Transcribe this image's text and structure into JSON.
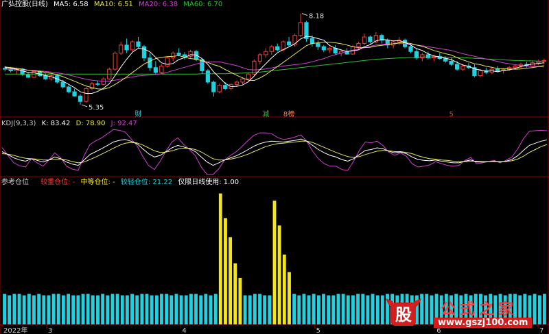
{
  "header1": {
    "title": "广弘控股(日线)",
    "ma5": "MA5: 6.58",
    "ma10": "MA10: 6.51",
    "ma20": "MA20: 6.38",
    "ma60": "MA60: 6.70"
  },
  "header2": {
    "title": "KDJ(9,3,3)",
    "k": "K: 83.42",
    "d": "D: 78.90",
    "j": "J: 92.47"
  },
  "header3": {
    "title": "参考仓位",
    "heavy": "较重仓位: -",
    "medium": "中等仓位: -",
    "light": "较轻仓位: 21.22",
    "note": "仅限日线使用: 1.00"
  },
  "markers": [
    "财",
    "减",
    "8榜",
    "5"
  ],
  "watermark": {
    "logo_char": "股",
    "title": "公式之家",
    "url": "www.gszj100.com"
  },
  "colors": {
    "up": "#ff3b3b",
    "down": "#22d0e0",
    "ma5": "#ffffff",
    "ma10": "#e8e85a",
    "ma20": "#d040d0",
    "ma60": "#30c030",
    "k": "#ffffff",
    "d": "#e8e85a",
    "j": "#d040d0",
    "bar_light": "#22d0e0",
    "bar_medium": "#f4e41a",
    "grid": "#8b0000"
  },
  "chart_data": [
    {
      "type": "candlestick",
      "title": "广弘控股(日线)",
      "x_ticks": [
        "2022年",
        "3",
        "4",
        "5",
        "6",
        "7"
      ],
      "annotations": [
        {
          "text": "8.18",
          "kind": "high"
        },
        {
          "text": "5.35",
          "kind": "low"
        }
      ],
      "ylim": [
        5.2,
        8.3
      ],
      "ohlc": [
        [
          6.48,
          6.55,
          6.38,
          6.45
        ],
        [
          6.45,
          6.52,
          6.35,
          6.4
        ],
        [
          6.4,
          6.5,
          6.3,
          6.46
        ],
        [
          6.46,
          6.48,
          6.25,
          6.28
        ],
        [
          6.28,
          6.34,
          6.18,
          6.2
        ],
        [
          6.2,
          6.4,
          6.18,
          6.38
        ],
        [
          6.38,
          6.42,
          6.22,
          6.25
        ],
        [
          6.25,
          6.32,
          6.12,
          6.15
        ],
        [
          6.15,
          6.28,
          6.1,
          6.25
        ],
        [
          6.25,
          6.3,
          6.0,
          6.05
        ],
        [
          6.05,
          6.12,
          5.85,
          5.9
        ],
        [
          5.9,
          5.95,
          5.7,
          5.75
        ],
        [
          5.75,
          5.85,
          5.6,
          5.62
        ],
        [
          5.62,
          5.68,
          5.35,
          5.45
        ],
        [
          5.45,
          5.9,
          5.42,
          5.85
        ],
        [
          5.85,
          6.05,
          5.8,
          6.0
        ],
        [
          6.0,
          6.1,
          5.92,
          5.98
        ],
        [
          5.98,
          6.2,
          5.95,
          6.15
        ],
        [
          6.15,
          6.5,
          6.12,
          6.45
        ],
        [
          6.45,
          7.0,
          6.4,
          6.95
        ],
        [
          6.95,
          7.3,
          6.9,
          7.2
        ],
        [
          7.2,
          7.4,
          6.95,
          7.05
        ],
        [
          7.05,
          7.35,
          7.0,
          7.3
        ],
        [
          7.3,
          7.45,
          7.1,
          7.15
        ],
        [
          7.15,
          7.2,
          6.7,
          6.8
        ],
        [
          6.8,
          6.95,
          6.4,
          6.5
        ],
        [
          6.5,
          6.7,
          6.3,
          6.35
        ],
        [
          6.35,
          6.6,
          6.3,
          6.55
        ],
        [
          6.55,
          6.85,
          6.5,
          6.8
        ],
        [
          6.8,
          7.0,
          6.7,
          6.95
        ],
        [
          6.95,
          7.1,
          6.85,
          6.9
        ],
        [
          6.9,
          6.98,
          6.75,
          6.85
        ],
        [
          6.85,
          7.05,
          6.8,
          7.0
        ],
        [
          7.0,
          7.05,
          6.7,
          6.75
        ],
        [
          6.75,
          6.8,
          6.3,
          6.4
        ],
        [
          6.4,
          6.45,
          6.0,
          6.05
        ],
        [
          6.05,
          6.1,
          5.6,
          5.75
        ],
        [
          5.75,
          6.0,
          5.7,
          5.95
        ],
        [
          5.95,
          6.05,
          5.8,
          5.85
        ],
        [
          5.85,
          6.0,
          5.8,
          5.98
        ],
        [
          5.98,
          6.1,
          5.9,
          6.05
        ],
        [
          6.05,
          6.2,
          5.98,
          6.15
        ],
        [
          6.15,
          6.35,
          6.1,
          6.3
        ],
        [
          6.3,
          6.75,
          6.25,
          6.7
        ],
        [
          6.7,
          6.95,
          6.6,
          6.9
        ],
        [
          6.9,
          7.1,
          6.8,
          7.0
        ],
        [
          7.0,
          7.2,
          6.9,
          7.15
        ],
        [
          7.15,
          7.25,
          7.0,
          7.05
        ],
        [
          7.05,
          7.35,
          7.0,
          7.3
        ],
        [
          7.3,
          7.45,
          7.15,
          7.2
        ],
        [
          7.2,
          7.55,
          7.15,
          7.5
        ],
        [
          7.5,
          8.18,
          7.45,
          7.9
        ],
        [
          7.9,
          7.95,
          7.3,
          7.4
        ],
        [
          7.4,
          7.5,
          7.15,
          7.25
        ],
        [
          7.25,
          7.35,
          7.05,
          7.15
        ],
        [
          7.15,
          7.2,
          6.98,
          7.05
        ],
        [
          7.05,
          7.15,
          6.95,
          7.1
        ],
        [
          7.1,
          7.2,
          6.9,
          6.95
        ],
        [
          6.95,
          7.05,
          6.85,
          7.0
        ],
        [
          7.0,
          7.1,
          6.9,
          6.92
        ],
        [
          6.92,
          7.2,
          6.9,
          7.15
        ],
        [
          7.15,
          7.3,
          7.05,
          7.25
        ],
        [
          7.25,
          7.55,
          7.2,
          7.45
        ],
        [
          7.45,
          7.5,
          7.2,
          7.3
        ],
        [
          7.3,
          7.6,
          7.25,
          7.5
        ],
        [
          7.5,
          7.55,
          7.25,
          7.35
        ],
        [
          7.35,
          7.4,
          7.1,
          7.2
        ],
        [
          7.2,
          7.35,
          7.1,
          7.3
        ],
        [
          7.3,
          7.45,
          7.2,
          7.35
        ],
        [
          7.35,
          7.4,
          7.1,
          7.15
        ],
        [
          7.15,
          7.25,
          6.95,
          7.0
        ],
        [
          7.0,
          7.1,
          6.75,
          6.8
        ],
        [
          6.8,
          6.95,
          6.7,
          6.9
        ],
        [
          6.9,
          7.0,
          6.75,
          6.8
        ],
        [
          6.8,
          6.9,
          6.7,
          6.85
        ],
        [
          6.85,
          6.95,
          6.75,
          6.78
        ],
        [
          6.78,
          6.85,
          6.65,
          6.7
        ],
        [
          6.7,
          6.8,
          6.55,
          6.6
        ],
        [
          6.6,
          6.7,
          6.4,
          6.45
        ],
        [
          6.45,
          6.6,
          6.4,
          6.55
        ],
        [
          6.55,
          6.65,
          6.45,
          6.5
        ],
        [
          6.5,
          6.6,
          6.2,
          6.25
        ],
        [
          6.25,
          6.45,
          6.2,
          6.4
        ],
        [
          6.4,
          6.5,
          6.3,
          6.35
        ],
        [
          6.35,
          6.5,
          6.3,
          6.45
        ],
        [
          6.45,
          6.55,
          6.35,
          6.4
        ],
        [
          6.4,
          6.48,
          6.32,
          6.44
        ],
        [
          6.44,
          6.55,
          6.4,
          6.5
        ],
        [
          6.5,
          6.6,
          6.45,
          6.55
        ],
        [
          6.55,
          6.65,
          6.48,
          6.6
        ],
        [
          6.6,
          6.68,
          6.5,
          6.55
        ],
        [
          6.55,
          6.7,
          6.5,
          6.65
        ],
        [
          6.65,
          6.75,
          6.58,
          6.7
        ],
        [
          6.7,
          6.78,
          6.6,
          6.72
        ]
      ],
      "ma5": [
        6.5,
        6.48,
        6.45,
        6.4,
        6.35,
        6.34,
        6.3,
        6.25,
        6.22,
        6.15,
        6.08,
        5.98,
        5.88,
        5.75,
        5.7,
        5.7,
        5.76,
        5.86,
        6.0,
        6.25,
        6.52,
        6.76,
        6.98,
        7.1,
        7.08,
        6.99,
        6.82,
        6.65,
        6.6,
        6.63,
        6.75,
        6.81,
        6.9,
        6.89,
        6.78,
        6.6,
        6.37,
        6.19,
        6.01,
        5.91,
        5.92,
        5.96,
        6.06,
        6.24,
        6.44,
        6.62,
        6.8,
        6.96,
        7.06,
        7.14,
        7.24,
        7.39,
        7.47,
        7.45,
        7.4,
        7.35,
        7.19,
        7.1,
        7.05,
        7.0,
        7.02,
        7.05,
        7.15,
        7.21,
        7.33,
        7.37,
        7.36,
        7.33,
        7.34,
        7.28,
        7.2,
        7.09,
        7.03,
        6.93,
        6.86,
        6.83,
        6.79,
        6.75,
        6.66,
        6.58,
        6.54,
        6.46,
        6.43,
        6.39,
        6.4,
        6.37,
        6.41,
        6.43,
        6.47,
        6.53,
        6.58,
        6.61,
        6.63,
        6.65
      ],
      "ma10": [
        6.52,
        6.5,
        6.48,
        6.45,
        6.42,
        6.4,
        6.38,
        6.35,
        6.32,
        6.28,
        6.22,
        6.15,
        6.08,
        6.0,
        5.93,
        5.88,
        5.84,
        5.83,
        5.88,
        5.98,
        6.09,
        6.21,
        6.35,
        6.48,
        6.61,
        6.7,
        6.78,
        6.82,
        6.84,
        6.85,
        6.87,
        6.82,
        6.78,
        6.76,
        6.71,
        6.66,
        6.59,
        6.54,
        6.44,
        6.35,
        6.26,
        6.18,
        6.11,
        6.1,
        6.18,
        6.28,
        6.41,
        6.53,
        6.66,
        6.79,
        6.92,
        7.05,
        7.18,
        7.25,
        7.27,
        7.29,
        7.29,
        7.27,
        7.24,
        7.2,
        7.15,
        7.12,
        7.12,
        7.13,
        7.17,
        7.19,
        7.21,
        7.24,
        7.27,
        7.27,
        7.25,
        7.2,
        7.16,
        7.1,
        7.03,
        6.98,
        6.93,
        6.89,
        6.81,
        6.74,
        6.68,
        6.62,
        6.59,
        6.54,
        6.51,
        6.47,
        6.47,
        6.46,
        6.45,
        6.46,
        6.48,
        6.5,
        6.53,
        6.56
      ],
      "ma20": [
        6.45,
        6.45,
        6.44,
        6.43,
        6.42,
        6.41,
        6.4,
        6.38,
        6.36,
        6.34,
        6.31,
        6.27,
        6.23,
        6.18,
        6.14,
        6.11,
        6.09,
        6.08,
        6.08,
        6.11,
        6.14,
        6.18,
        6.21,
        6.24,
        6.26,
        6.27,
        6.29,
        6.31,
        6.35,
        6.41,
        6.46,
        6.51,
        6.56,
        6.61,
        6.66,
        6.68,
        6.68,
        6.68,
        6.64,
        6.6,
        6.56,
        6.5,
        6.44,
        6.43,
        6.44,
        6.46,
        6.49,
        6.53,
        6.55,
        6.57,
        6.59,
        6.61,
        6.64,
        6.68,
        6.73,
        6.78,
        6.85,
        6.9,
        6.95,
        7.0,
        7.04,
        7.08,
        7.12,
        7.16,
        7.2,
        7.22,
        7.23,
        7.24,
        7.25,
        7.24,
        7.22,
        7.2,
        7.18,
        7.15,
        7.12,
        7.09,
        7.06,
        7.03,
        6.98,
        6.93,
        6.89,
        6.85,
        6.81,
        6.77,
        6.73,
        6.69,
        6.65,
        6.62,
        6.59,
        6.57,
        6.55,
        6.54,
        6.53,
        6.52
      ],
      "ma60": [
        6.3,
        6.3,
        6.3,
        6.3,
        6.3,
        6.3,
        6.3,
        6.3,
        6.3,
        6.3,
        6.3,
        6.3,
        6.3,
        6.3,
        6.3,
        6.3,
        6.3,
        6.3,
        6.3,
        6.3,
        6.3,
        6.3,
        6.3,
        6.3,
        6.3,
        6.3,
        6.3,
        6.3,
        6.3,
        6.3,
        6.3,
        6.3,
        6.3,
        6.3,
        6.31,
        6.31,
        6.31,
        6.31,
        6.31,
        6.32,
        6.32,
        6.33,
        6.34,
        6.35,
        6.36,
        6.38,
        6.4,
        6.42,
        6.44,
        6.46,
        6.48,
        6.5,
        6.52,
        6.54,
        6.56,
        6.58,
        6.6,
        6.62,
        6.64,
        6.66,
        6.68,
        6.7,
        6.72,
        6.74,
        6.76,
        6.77,
        6.78,
        6.79,
        6.8,
        6.81,
        6.82,
        6.82,
        6.83,
        6.83,
        6.83,
        6.83,
        6.83,
        6.82,
        6.82,
        6.81,
        6.8,
        6.79,
        6.78,
        6.77,
        6.76,
        6.75,
        6.74,
        6.73,
        6.72,
        6.72,
        6.71,
        6.71,
        6.7,
        6.7
      ]
    },
    {
      "type": "line",
      "title": "KDJ(9,3,3)",
      "ylim": [
        0,
        110
      ],
      "k": [
        55,
        48,
        40,
        35,
        32,
        38,
        34,
        30,
        35,
        42,
        38,
        30,
        25,
        22,
        35,
        48,
        55,
        62,
        70,
        78,
        82,
        84,
        80,
        74,
        62,
        50,
        42,
        46,
        55,
        64,
        70,
        66,
        62,
        55,
        42,
        30,
        22,
        28,
        35,
        40,
        45,
        52,
        60,
        68,
        74,
        78,
        80,
        79,
        78,
        80,
        82,
        85,
        80,
        70,
        60,
        52,
        46,
        42,
        36,
        32,
        38,
        48,
        58,
        60,
        64,
        62,
        56,
        52,
        54,
        50,
        42,
        36,
        34,
        33,
        35,
        32,
        30,
        28,
        28,
        32,
        35,
        30,
        30,
        31,
        32,
        30,
        32,
        36,
        45,
        58,
        70,
        75,
        80,
        83
      ],
      "d": [
        50,
        49,
        46,
        42,
        39,
        38,
        37,
        35,
        35,
        37,
        37,
        35,
        31,
        28,
        30,
        36,
        42,
        49,
        56,
        63,
        70,
        75,
        77,
        76,
        71,
        64,
        57,
        53,
        54,
        57,
        61,
        63,
        63,
        60,
        54,
        46,
        38,
        35,
        35,
        37,
        40,
        44,
        49,
        55,
        61,
        67,
        71,
        74,
        75,
        77,
        78,
        80,
        80,
        77,
        71,
        65,
        59,
        53,
        48,
        43,
        41,
        43,
        48,
        52,
        56,
        58,
        57,
        55,
        55,
        53,
        50,
        45,
        41,
        38,
        37,
        35,
        34,
        32,
        31,
        31,
        32,
        32,
        31,
        31,
        31,
        31,
        31,
        33,
        37,
        44,
        53,
        60,
        67,
        72
      ],
      "j": [
        65,
        46,
        28,
        21,
        18,
        38,
        28,
        20,
        35,
        52,
        40,
        20,
        13,
        10,
        45,
        72,
        81,
        88,
        98,
        108,
        106,
        102,
        86,
        70,
        44,
        22,
        12,
        32,
        57,
        78,
        88,
        72,
        60,
        45,
        18,
        0,
        0,
        14,
        35,
        46,
        55,
        68,
        82,
        94,
        100,
        100,
        98,
        89,
        84,
        86,
        90,
        95,
        80,
        56,
        38,
        26,
        20,
        20,
        12,
        10,
        32,
        58,
        78,
        76,
        80,
        70,
        54,
        46,
        52,
        44,
        26,
        18,
        20,
        23,
        31,
        26,
        22,
        20,
        22,
        34,
        41,
        26,
        28,
        31,
        34,
        28,
        34,
        42,
        61,
        86,
        104,
        105,
        106,
        105
      ]
    },
    {
      "type": "bar",
      "title": "参考仓位",
      "series_names": [
        "较重仓位",
        "中等仓位",
        "较轻仓位"
      ],
      "ylim": [
        0,
        95
      ],
      "values": [
        21,
        20,
        21,
        21,
        20,
        21,
        20,
        21,
        20,
        20,
        21,
        21,
        20,
        21,
        20,
        20,
        21,
        21,
        20,
        20,
        21,
        20,
        21,
        21,
        20,
        20,
        21,
        20,
        21,
        21,
        20,
        20,
        21,
        21,
        20,
        21,
        20,
        20,
        21,
        21,
        20,
        21,
        20,
        21,
        20,
        21,
        21,
        20,
        21,
        20,
        20,
        21,
        21,
        20,
        20,
        21,
        21,
        20,
        21,
        21,
        20,
        21,
        20,
        21,
        20,
        21,
        20,
        20,
        21,
        21,
        20,
        20,
        21,
        21,
        20,
        21,
        20,
        20,
        21,
        21,
        20,
        21,
        21,
        20,
        20,
        21,
        21,
        20,
        21,
        20,
        21,
        20,
        21,
        20,
        21,
        20,
        21,
        21,
        20,
        21,
        20,
        21,
        20,
        21,
        21,
        20,
        21,
        20,
        21,
        20,
        21
      ],
      "medium_values": [
        {
          "i": 44,
          "v": 90
        },
        {
          "i": 45,
          "v": 73
        },
        {
          "i": 46,
          "v": 60
        },
        {
          "i": 47,
          "v": 42
        },
        {
          "i": 48,
          "v": 32
        },
        {
          "i": 55,
          "v": 85
        },
        {
          "i": 56,
          "v": 68
        },
        {
          "i": 57,
          "v": 48
        },
        {
          "i": 58,
          "v": 36
        }
      ]
    }
  ]
}
